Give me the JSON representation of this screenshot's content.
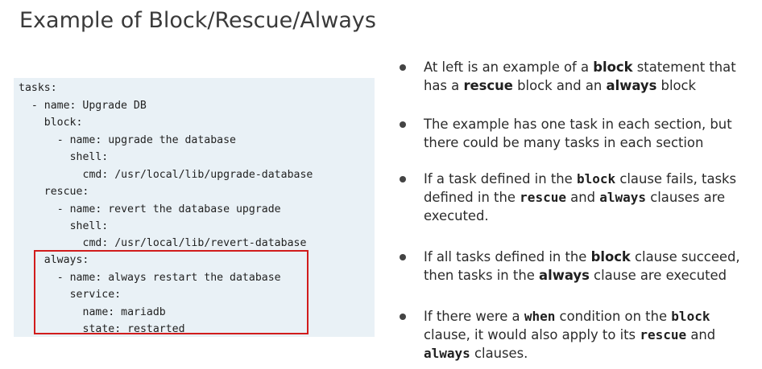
{
  "slide": {
    "title": "Example of Block/Rescue/Always"
  },
  "code": {
    "lines": [
      "tasks:",
      "  - name: Upgrade DB",
      "    block:",
      "      - name: upgrade the database",
      "        shell:",
      "          cmd: /usr/local/lib/upgrade-database",
      "    rescue:",
      "      - name: revert the database upgrade",
      "        shell:",
      "          cmd: /usr/local/lib/revert-database",
      "    always:",
      "      - name: always restart the database",
      "        service:",
      "          name: mariadb",
      "          state: restarted"
    ],
    "highlight_color": "#d11c1c",
    "panel_color": "#e9f1f6"
  },
  "bullets": [
    {
      "segments": [
        {
          "text": "At left is an example of a ",
          "style": "normal"
        },
        {
          "text": "block",
          "style": "bold"
        },
        {
          "text": " statement that has a ",
          "style": "normal"
        },
        {
          "text": "rescue",
          "style": "bold"
        },
        {
          "text": " block and an ",
          "style": "normal"
        },
        {
          "text": "always",
          "style": "bold"
        },
        {
          "text": " block",
          "style": "normal"
        }
      ]
    },
    {
      "segments": [
        {
          "text": "The example has one task in each section, but there could be many tasks in each section",
          "style": "normal"
        }
      ]
    },
    {
      "segments": [
        {
          "text": "If a task defined in the ",
          "style": "normal"
        },
        {
          "text": "block",
          "style": "mono"
        },
        {
          "text": " clause fails, tasks defined in the ",
          "style": "normal"
        },
        {
          "text": "rescue",
          "style": "mono"
        },
        {
          "text": " and ",
          "style": "normal"
        },
        {
          "text": "always",
          "style": "mono"
        },
        {
          "text": " clauses are executed.",
          "style": "normal"
        }
      ]
    },
    {
      "segments": [
        {
          "text": "If all tasks defined in the ",
          "style": "normal"
        },
        {
          "text": "block",
          "style": "bold"
        },
        {
          "text": " clause succeed, then tasks in the ",
          "style": "normal"
        },
        {
          "text": "always",
          "style": "bold"
        },
        {
          "text": " clause are executed",
          "style": "normal"
        }
      ]
    },
    {
      "segments": [
        {
          "text": "If there were a ",
          "style": "normal"
        },
        {
          "text": "when",
          "style": "mono"
        },
        {
          "text": " condition on the ",
          "style": "normal"
        },
        {
          "text": "block",
          "style": "mono"
        },
        {
          "text": " clause, it would also apply to its ",
          "style": "normal"
        },
        {
          "text": "rescue",
          "style": "mono"
        },
        {
          "text": " and ",
          "style": "normal"
        },
        {
          "text": "always",
          "style": "mono"
        },
        {
          "text": " clauses.",
          "style": "normal"
        }
      ]
    }
  ]
}
